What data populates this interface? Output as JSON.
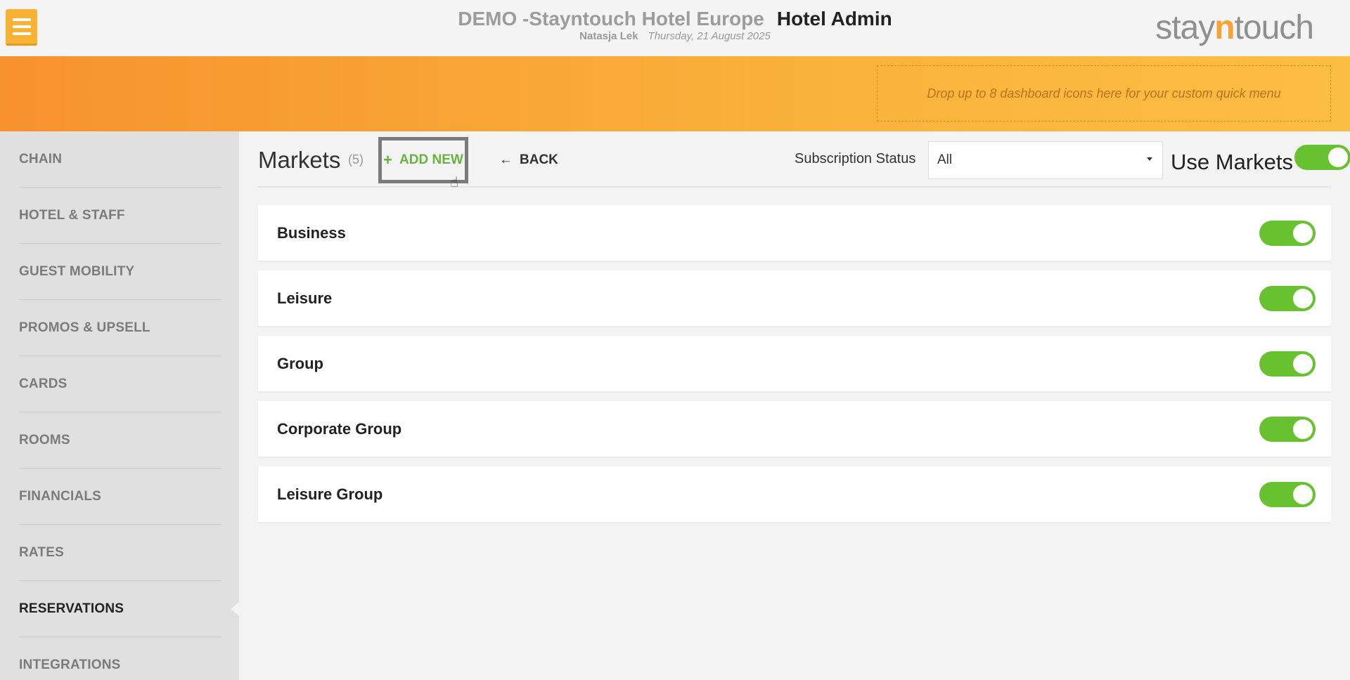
{
  "header": {
    "hotel_name": "DEMO -Stayntouch Hotel Europe",
    "app_name": "Hotel Admin",
    "user": "Natasja Lek",
    "date": "Thursday, 21 August 2025",
    "logo_part1": "stay",
    "logo_part2": "n",
    "logo_part3": "touch"
  },
  "quick_menu": {
    "placeholder": "Drop up to 8 dashboard icons here for your custom quick menu"
  },
  "sidebar": {
    "items": [
      {
        "label": "CHAIN"
      },
      {
        "label": "HOTEL & STAFF"
      },
      {
        "label": "GUEST MOBILITY"
      },
      {
        "label": "PROMOS & UPSELL"
      },
      {
        "label": "CARDS"
      },
      {
        "label": "ROOMS"
      },
      {
        "label": "FINANCIALS"
      },
      {
        "label": "RATES"
      },
      {
        "label": "RESERVATIONS"
      },
      {
        "label": "INTEGRATIONS"
      }
    ],
    "active": "RESERVATIONS"
  },
  "toolbar": {
    "title": "Markets",
    "count": "(5)",
    "add_new_label": "ADD NEW",
    "back_label": "BACK",
    "subscription_label": "Subscription Status",
    "subscription_value": "All",
    "use_markets_label": "Use Markets",
    "use_markets_on": true
  },
  "markets": [
    {
      "name": "Business",
      "enabled": true
    },
    {
      "name": "Leisure",
      "enabled": true
    },
    {
      "name": "Group",
      "enabled": true
    },
    {
      "name": "Corporate Group",
      "enabled": true
    },
    {
      "name": "Leisure Group",
      "enabled": true
    }
  ],
  "colors": {
    "accent_orange": "#f9b233",
    "toggle_green": "#68c12e",
    "add_new_green": "#6ab23e"
  }
}
